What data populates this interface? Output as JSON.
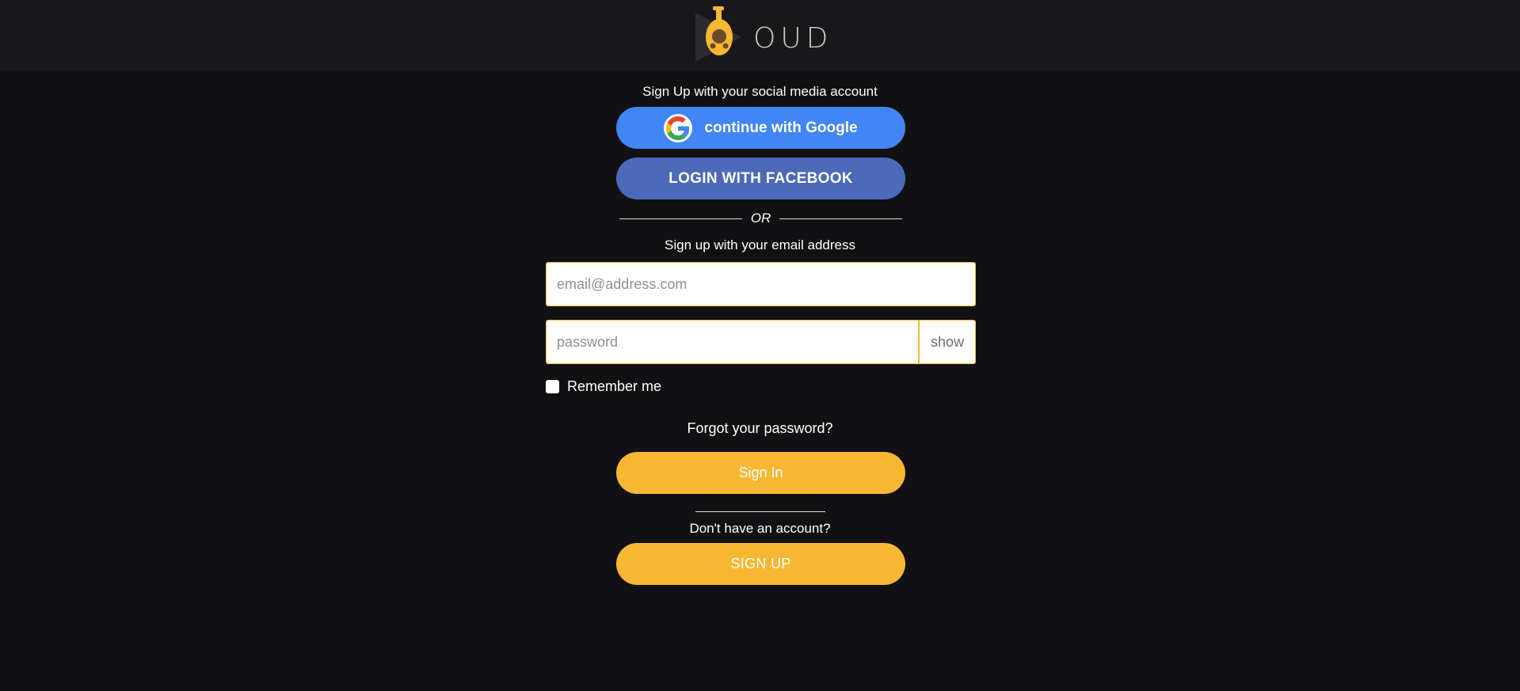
{
  "header": {
    "logo_text": "OUD"
  },
  "social": {
    "heading": "Sign Up with your social media account",
    "google_label": "continue with Google",
    "facebook_label": "LOGIN WITH FACEBOOK"
  },
  "separator": {
    "or_text": "OR"
  },
  "email_section": {
    "heading": "Sign up with your email address",
    "email_placeholder": "email@address.com",
    "email_value": "",
    "password_placeholder": "password",
    "password_value": "",
    "show_label": "show",
    "remember_label": "Remember me",
    "remember_checked": false,
    "forgot_label": "Forgot your password?",
    "signin_label": "Sign In"
  },
  "signup_section": {
    "prompt": "Don't have an account?",
    "signup_label": "SIGN UP"
  },
  "colors": {
    "background": "#111113",
    "header_bg": "#18181a",
    "accent_yellow": "#f7b733",
    "google_blue": "#4285f4",
    "facebook_blue": "#4c69ba"
  },
  "icons": {
    "logo": "oud-instrument-play-logo",
    "google": "google-g-icon"
  }
}
